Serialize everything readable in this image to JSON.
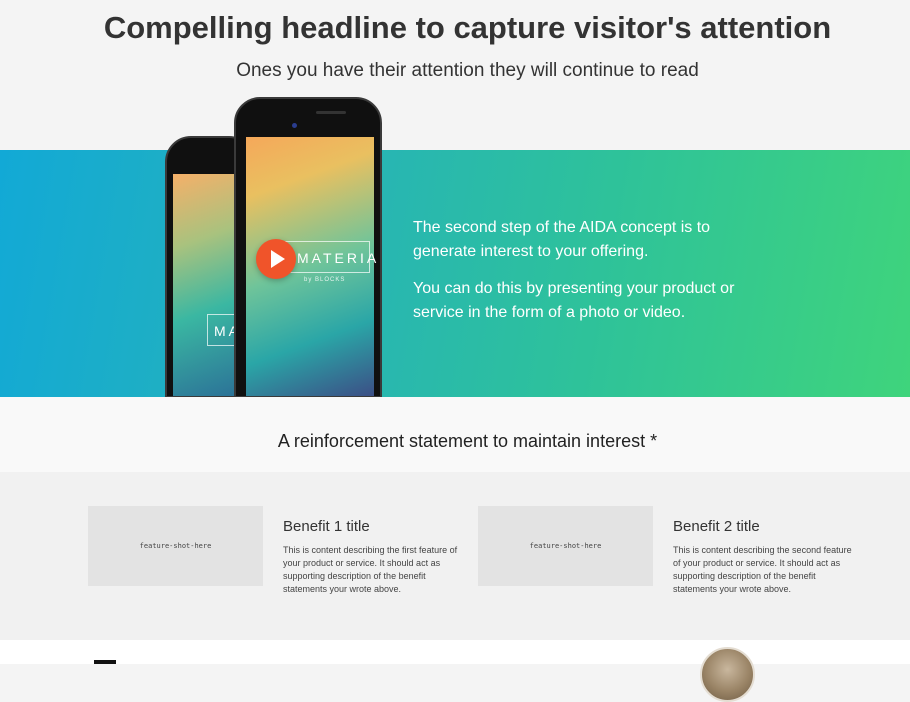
{
  "hero": {
    "headline": "Compelling headline to capture visitor's attention",
    "subheadline": "Ones you have their attention they will continue to read"
  },
  "interest_band": {
    "paragraph_1": "The second step of the AIDA concept is to generate interest to your offering.",
    "paragraph_2": "You can do this by presenting your product or service in the form of a photo or video.",
    "phone_logo": "MATERIA",
    "phone_logo_back": "MA",
    "phone_logo_sub": "by BLOCKS"
  },
  "reinforcement": {
    "statement": "A reinforcement statement to maintain interest *"
  },
  "benefits": [
    {
      "shot_placeholder": "feature-shot-here",
      "title": "Benefit 1 title",
      "description": "This is content describing the first feature of your product or service. It should act as supporting description of the benefit statements your wrote above."
    },
    {
      "shot_placeholder": "feature-shot-here",
      "title": "Benefit 2 title",
      "description": "This is content describing the second feature of your product or service. It should act as supporting description of the benefit statements your wrote above."
    }
  ],
  "colors": {
    "band_start": "#12a9d6",
    "band_end": "#3fd47c",
    "play_button": "#f0542a"
  },
  "icons": [
    "play-icon",
    "quote-icon",
    "avatar"
  ]
}
